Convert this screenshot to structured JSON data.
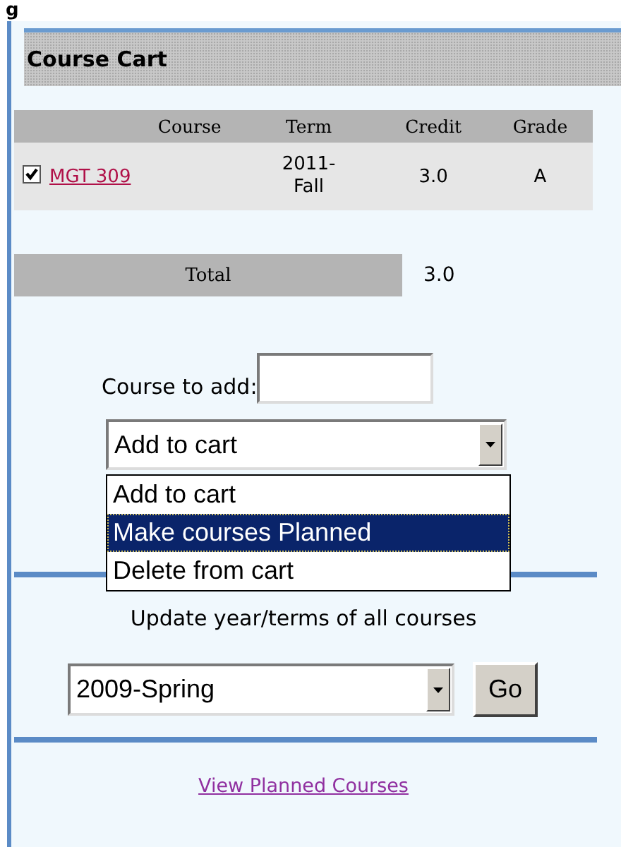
{
  "page_heading": "g",
  "panel": {
    "title": "Course Cart"
  },
  "table": {
    "columns": [
      "Course",
      "Term",
      "Credit",
      "Grade"
    ],
    "rows": [
      {
        "checked": true,
        "course": "MGT 309",
        "term": "2011-Fall",
        "credit": "3.0",
        "grade": "A"
      }
    ]
  },
  "total": {
    "label": "Total",
    "value": "3.0"
  },
  "add_form": {
    "label": "Course to add:",
    "action_select": {
      "value": "Add to cart",
      "expanded": true,
      "options": [
        {
          "label": "Add to cart",
          "highlighted": false
        },
        {
          "label": "Make courses Planned",
          "highlighted": true
        },
        {
          "label": "Delete from cart",
          "highlighted": false
        }
      ]
    }
  },
  "update": {
    "label": "Update year/terms of all courses",
    "term_select": {
      "value": "2009-Spring"
    },
    "go_button": "Go"
  },
  "link": "View Planned Courses"
}
